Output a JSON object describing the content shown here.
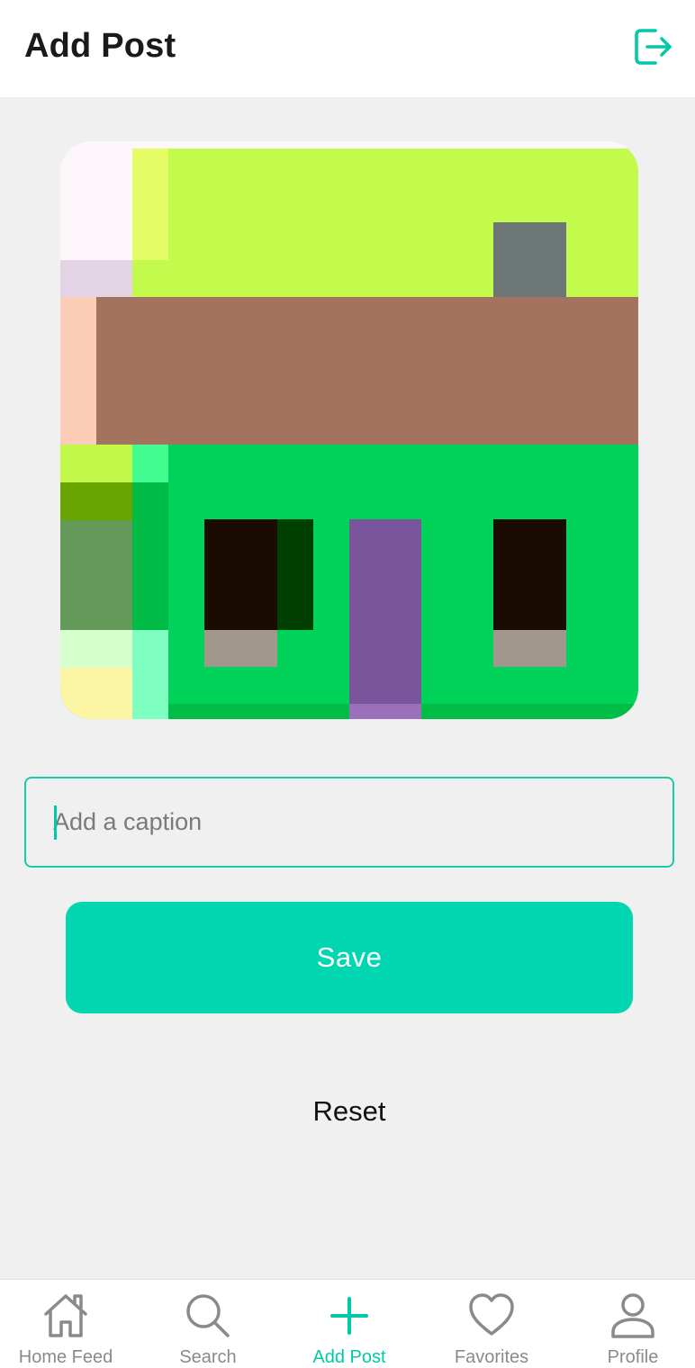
{
  "header": {
    "title": "Add Post",
    "logout_icon": "logout-icon"
  },
  "preview": {
    "icon": "pixel-house-image"
  },
  "caption": {
    "placeholder": "Add a caption",
    "value": ""
  },
  "actions": {
    "save_label": "Save",
    "reset_label": "Reset"
  },
  "nav": {
    "items": [
      {
        "label": "Home Feed",
        "icon": "home-icon",
        "active": false
      },
      {
        "label": "Search",
        "icon": "search-icon",
        "active": false
      },
      {
        "label": "Add Post",
        "icon": "plus-icon",
        "active": true
      },
      {
        "label": "Favorites",
        "icon": "heart-icon",
        "active": false
      },
      {
        "label": "Profile",
        "icon": "user-icon",
        "active": false
      }
    ]
  },
  "colors": {
    "accent": "#00d6af",
    "accent_text": "#00c9a7",
    "inactive": "#8a8a8a",
    "background": "#f0f0f0"
  }
}
